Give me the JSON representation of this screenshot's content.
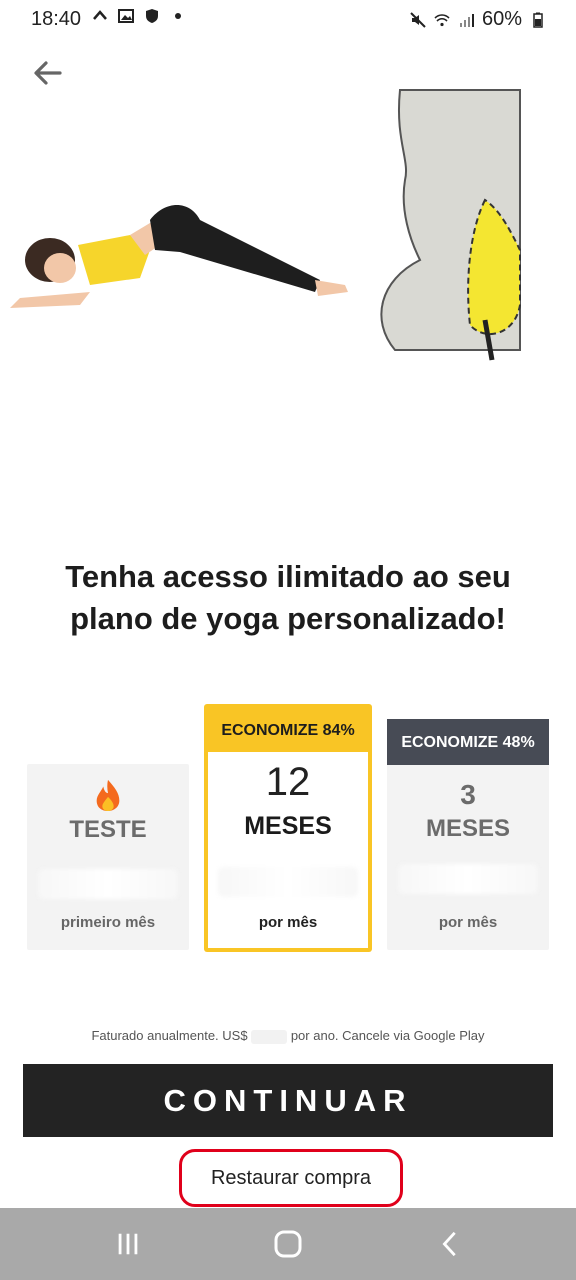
{
  "status_bar": {
    "time": "18:40",
    "battery": "60%"
  },
  "page": {
    "title_line1": "Tenha acesso ilimitado ao seu",
    "title_line2": "plano de yoga personalizado!"
  },
  "plans": [
    {
      "name": "TESTE",
      "note": "primeiro mês",
      "icon": "fire-icon"
    },
    {
      "badge": "ECONOMIZE 84%",
      "number": "12",
      "unit": "MESES",
      "note": "por mês"
    },
    {
      "badge": "ECONOMIZE 48%",
      "number": "3",
      "unit": "MESES",
      "note": "por mês"
    }
  ],
  "billing": {
    "prefix": "Faturado anualmente. US$",
    "suffix": "por ano. Cancele via Google Play"
  },
  "buttons": {
    "continue": "CONTINUAR",
    "restore": "Restaurar compra"
  },
  "colors": {
    "accent_yellow": "#f9c525",
    "dark_badge": "#474b55",
    "cta_bg": "#232323",
    "highlight_red": "#e0001b"
  }
}
